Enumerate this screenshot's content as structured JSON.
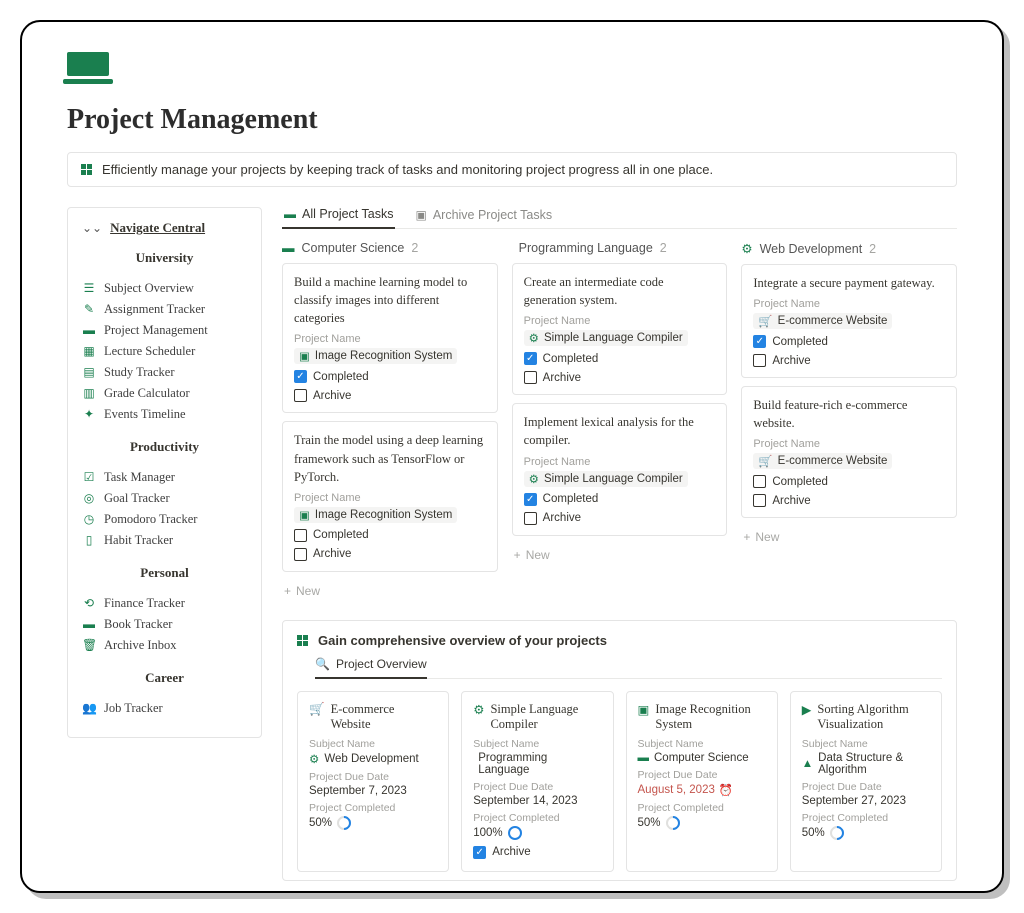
{
  "page_title": "Project Management",
  "intro": "Efficiently manage your projects by keeping track of tasks and monitoring project progress all in one place.",
  "sidebar": {
    "nav_title": "Navigate Central",
    "sections": [
      {
        "heading": "University",
        "items": [
          {
            "label": "Subject Overview",
            "icon": "list"
          },
          {
            "label": "Assignment Tracker",
            "icon": "pencil"
          },
          {
            "label": "Project Management",
            "icon": "laptop"
          },
          {
            "label": "Lecture Scheduler",
            "icon": "calendar"
          },
          {
            "label": "Study Tracker",
            "icon": "book-open"
          },
          {
            "label": "Grade Calculator",
            "icon": "abacus"
          },
          {
            "label": "Events Timeline",
            "icon": "sparkle"
          }
        ]
      },
      {
        "heading": "Productivity",
        "items": [
          {
            "label": "Task Manager",
            "icon": "check-square"
          },
          {
            "label": "Goal Tracker",
            "icon": "target"
          },
          {
            "label": "Pomodoro Tracker",
            "icon": "clock"
          },
          {
            "label": "Habit Tracker",
            "icon": "cup"
          }
        ]
      },
      {
        "heading": "Personal",
        "items": [
          {
            "label": "Finance Tracker",
            "icon": "money"
          },
          {
            "label": "Book Tracker",
            "icon": "book"
          },
          {
            "label": "Archive Inbox",
            "icon": "archive"
          }
        ]
      },
      {
        "heading": "Career",
        "items": [
          {
            "label": "Job Tracker",
            "icon": "briefcase"
          }
        ]
      }
    ]
  },
  "tabs": {
    "active": "All Project Tasks",
    "inactive": "Archive Project Tasks"
  },
  "groups": [
    {
      "name": "Computer Science",
      "count": "2",
      "icon": "laptop",
      "cards": [
        {
          "title": "Build a machine learning model to classify images into different categories",
          "project_label": "Project Name",
          "project": "Image Recognition System",
          "project_icon": "image",
          "completed_label": "Completed",
          "completed": true,
          "archive_label": "Archive",
          "archive": false
        },
        {
          "title": "Train the model using a deep learning framework such as TensorFlow or PyTorch.",
          "project_label": "Project Name",
          "project": "Image Recognition System",
          "project_icon": "image",
          "completed_label": "Completed",
          "completed": false,
          "archive_label": "Archive",
          "archive": false
        }
      ],
      "new_label": "New"
    },
    {
      "name": "Programming Language",
      "count": "2",
      "icon": "code",
      "cards": [
        {
          "title": "Create an intermediate code generation system.",
          "project_label": "Project Name",
          "project": "Simple Language Compiler",
          "project_icon": "compiler",
          "completed_label": "Completed",
          "completed": true,
          "archive_label": "Archive",
          "archive": false
        },
        {
          "title": "Implement lexical analysis for the compiler.",
          "project_label": "Project Name",
          "project": "Simple Language Compiler",
          "project_icon": "compiler",
          "completed_label": "Completed",
          "completed": true,
          "archive_label": "Archive",
          "archive": false
        }
      ],
      "new_label": "New"
    },
    {
      "name": "Web Development",
      "count": "2",
      "icon": "globe",
      "cards": [
        {
          "title": "Integrate a secure payment gateway.",
          "project_label": "Project Name",
          "project": "E-commerce Website",
          "project_icon": "cart",
          "completed_label": "Completed",
          "completed": true,
          "archive_label": "Archive",
          "archive": false
        },
        {
          "title": "Build feature-rich e-commerce website.",
          "project_label": "Project Name",
          "project": "E-commerce Website",
          "project_icon": "cart",
          "completed_label": "Completed",
          "completed": false,
          "archive_label": "Archive",
          "archive": false
        }
      ],
      "new_label": "New"
    }
  ],
  "overview": {
    "heading": "Gain comprehensive overview of your projects",
    "tab": "Project Overview",
    "cards": [
      {
        "title": "E-commerce Website",
        "icon": "cart",
        "subject_label": "Subject Name",
        "subject": "Web Development",
        "subject_icon": "globe",
        "due_label": "Project Due Date",
        "due": "September 7, 2023",
        "complete_label": "Project Completed",
        "percent": "50%",
        "ring": "half"
      },
      {
        "title": "Simple Language Compiler",
        "icon": "compiler",
        "subject_label": "Subject Name",
        "subject": "Programming Language",
        "subject_icon": "code",
        "due_label": "Project Due Date",
        "due": "September 14, 2023",
        "complete_label": "Project Completed",
        "percent": "100%",
        "ring": "full",
        "archive_label": "Archive",
        "archive": true
      },
      {
        "title": "Image Recognition System",
        "icon": "image",
        "subject_label": "Subject Name",
        "subject": "Computer Science",
        "subject_icon": "laptop",
        "due_label": "Project Due Date",
        "due": "August 5, 2023",
        "late": true,
        "complete_label": "Project Completed",
        "percent": "50%",
        "ring": "half"
      },
      {
        "title": "Sorting Algorithm Visualization",
        "icon": "sort",
        "subject_label": "Subject Name",
        "subject": "Data Structure & Algorithm",
        "subject_icon": "chart",
        "due_label": "Project Due Date",
        "due": "September 27, 2023",
        "complete_label": "Project Completed",
        "percent": "50%",
        "ring": "half"
      }
    ]
  },
  "icons_unicode": {
    "list": "☰",
    "pencil": "✎",
    "laptop": "💻",
    "calendar": "📅",
    "book-open": "📖",
    "abacus": "🧮",
    "sparkle": "✨",
    "check-square": "☑",
    "target": "◎",
    "clock": "⏱",
    "cup": "🥛",
    "money": "💱",
    "book": "📕",
    "archive": "🗑",
    "briefcase": "👥",
    "code": "</>",
    "globe": "⚙",
    "image": "🖼",
    "compiler": "⚙",
    "cart": "🛒",
    "sort": "▶",
    "chart": "📈"
  }
}
